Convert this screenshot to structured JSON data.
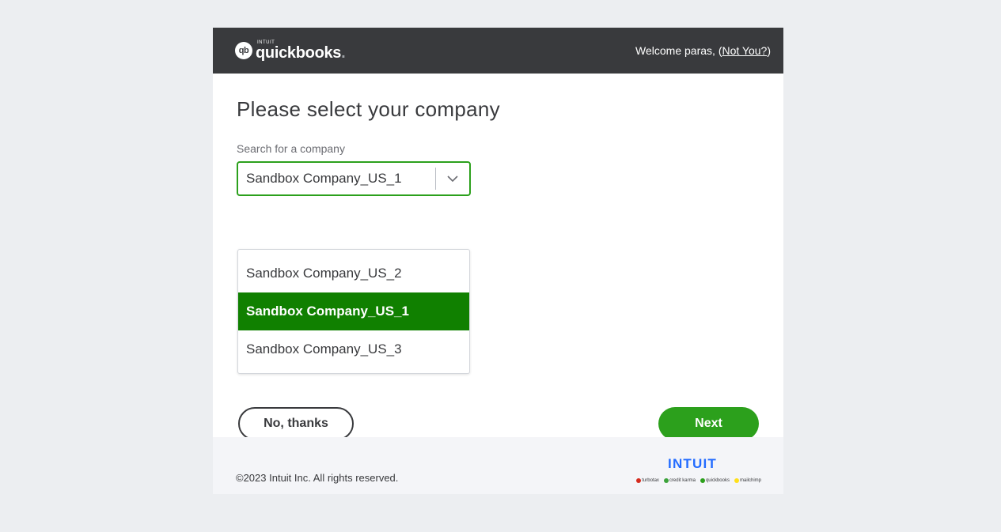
{
  "header": {
    "logo_intuit": "INTUIT",
    "logo_name": "quickbooks",
    "logo_dot": ".",
    "logo_mark": "qb",
    "welcome_text": "Welcome paras, ",
    "not_you_open": "(",
    "not_you_link": "Not You?",
    "not_you_close": ")"
  },
  "main": {
    "title": "Please select your company",
    "search_label": "Search for a company",
    "selected_value": "Sandbox Company_US_1",
    "options": [
      {
        "label": "Sandbox Company_US_2",
        "selected": false
      },
      {
        "label": "Sandbox Company_US_1",
        "selected": true
      },
      {
        "label": "Sandbox Company_US_3",
        "selected": false
      }
    ]
  },
  "actions": {
    "no_thanks_label": "No, thanks",
    "next_label": "Next"
  },
  "footer": {
    "copyright": "©2023 Intuit Inc. All rights reserved.",
    "intuit_logo": "INTUIT",
    "brands": [
      {
        "name": "turbotax",
        "color": "#d52b1e"
      },
      {
        "name": "credit karma",
        "color": "#3ca33b"
      },
      {
        "name": "quickbooks",
        "color": "#2ca01c"
      },
      {
        "name": "mailchimp",
        "color": "#ffe01b"
      }
    ]
  },
  "colors": {
    "header_bg": "#393a3d",
    "accent": "#2ca01c",
    "selected_option": "#108000",
    "intuit_blue": "#236cff"
  }
}
